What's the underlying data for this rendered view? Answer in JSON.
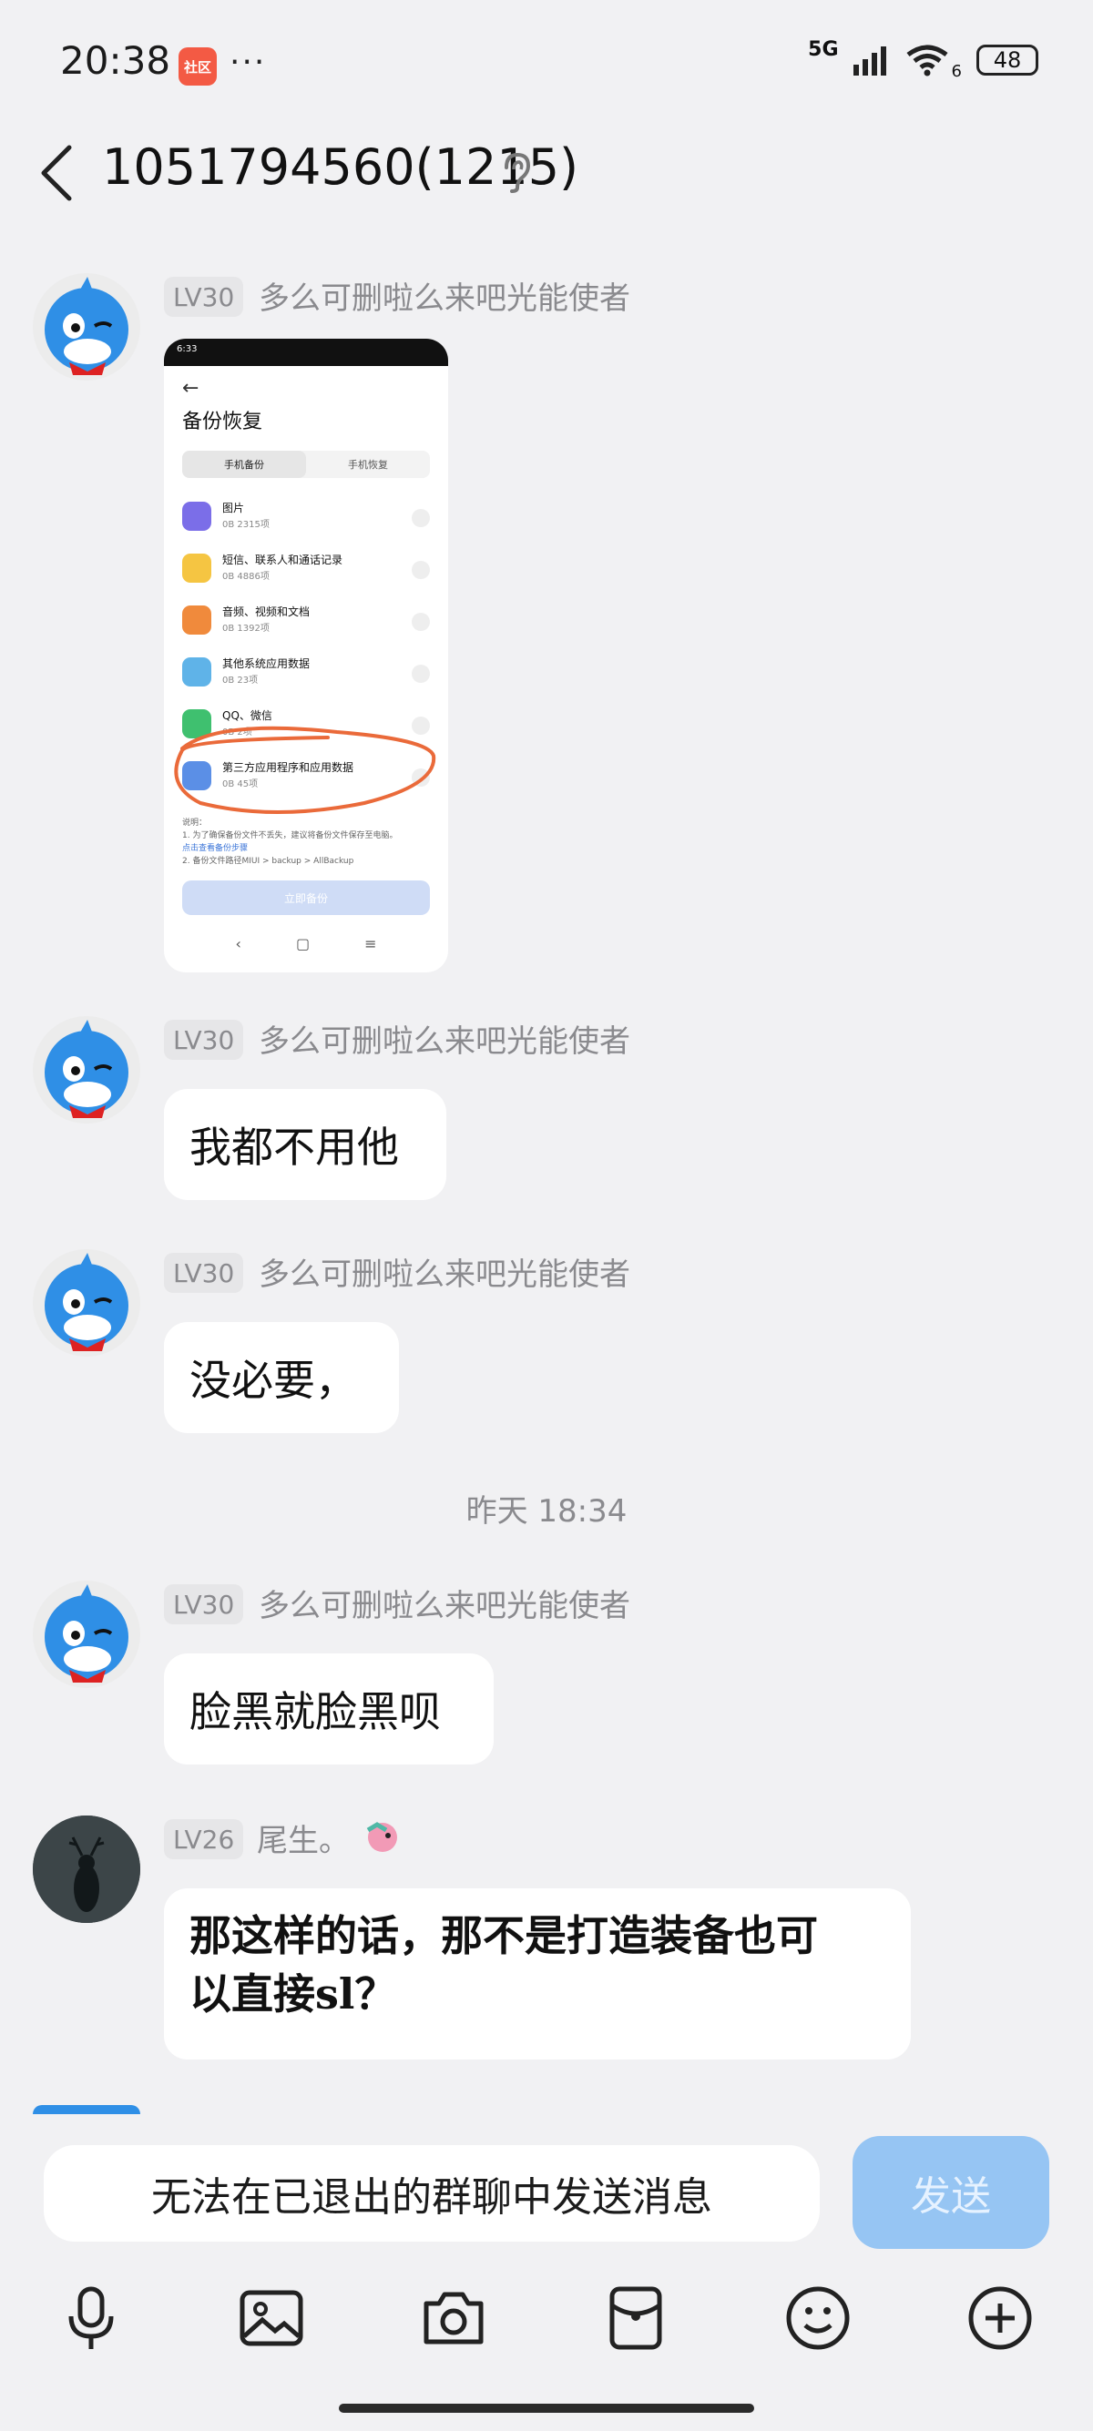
{
  "status": {
    "time": "20:38",
    "app_badge": "社区",
    "more": "···",
    "network": "5G",
    "wifi_extra": "6",
    "battery": "48"
  },
  "header": {
    "title": "1051794560(1215)"
  },
  "messages": [
    {
      "level": "LV30",
      "nick": "多么可删啦么来吧光能使者"
    },
    {
      "level": "LV30",
      "nick": "多么可删啦么来吧光能使者",
      "text": "我都不用他"
    },
    {
      "level": "LV30",
      "nick": "多么可删啦么来吧光能使者",
      "text": "没必要，"
    },
    {
      "level": "LV30",
      "nick": "多么可删啦么来吧光能使者",
      "text": "脸黑就脸黑呗"
    },
    {
      "level": "LV26",
      "nick": "尾生。",
      "text_line1": "那这样的话，那不是打造装备也可",
      "text_line2": "以直接sl？"
    }
  ],
  "timestamp": "昨天 18:34",
  "screenshot": {
    "status_time": "6:33",
    "title": "备份恢复",
    "tabs": [
      "手机备份",
      "手机恢复"
    ],
    "rows": [
      {
        "name": "图片",
        "sub": "0B  2315项",
        "color": "#7b6ee8"
      },
      {
        "name": "短信、联系人和通话记录",
        "sub": "0B  4886项",
        "color": "#f5c542"
      },
      {
        "name": "音频、视频和文档",
        "sub": "0B  1392项",
        "color": "#f08a3c"
      },
      {
        "name": "其他系统应用数据",
        "sub": "0B  23项",
        "color": "#5fb3e8"
      },
      {
        "name": "QQ、微信",
        "sub": "0B  2项",
        "color": "#3fc06f"
      },
      {
        "name": "第三方应用程序和应用数据",
        "sub": "0B  45项",
        "color": "#5b8fe6"
      }
    ],
    "note_title": "说明：",
    "note_1": "1. 为了确保备份文件不丢失，建议将备份文件保存至电脑。",
    "note_link": "点击查看备份步骤",
    "note_2": "2. 备份文件路径MIUI > backup > AllBackup",
    "button": "立即备份",
    "nav": [
      "‹",
      "▢",
      "≡"
    ]
  },
  "input": {
    "placeholder": "无法在已退出的群聊中发送消息",
    "send_label": "发送"
  },
  "toolbar": [
    "microphone-icon",
    "image-icon",
    "camera-icon",
    "red-packet-icon",
    "emoji-icon",
    "plus-icon"
  ],
  "colors": {
    "send": "#96c5f3",
    "bubble": "#ffffff",
    "background": "#f1f1f3"
  }
}
